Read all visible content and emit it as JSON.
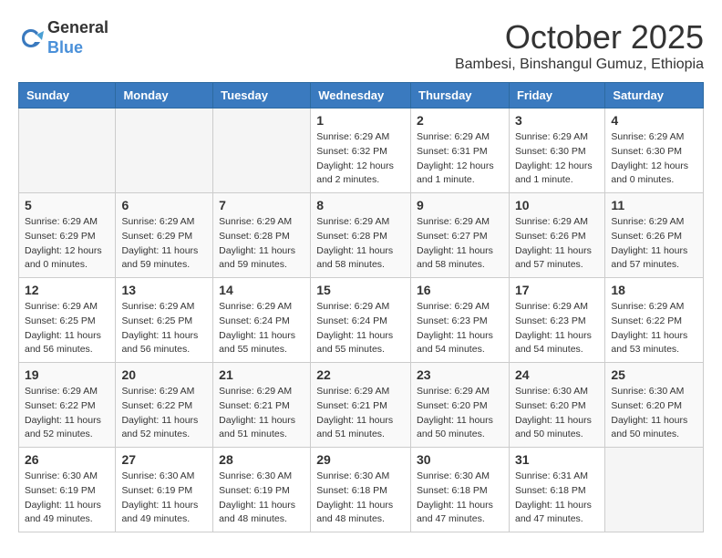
{
  "header": {
    "logo": {
      "line1": "General",
      "line2": "Blue"
    },
    "title": "October 2025",
    "subtitle": "Bambesi, Binshangul Gumuz, Ethiopia"
  },
  "calendar": {
    "days_of_week": [
      "Sunday",
      "Monday",
      "Tuesday",
      "Wednesday",
      "Thursday",
      "Friday",
      "Saturday"
    ],
    "weeks": [
      [
        {
          "day": "",
          "info": ""
        },
        {
          "day": "",
          "info": ""
        },
        {
          "day": "",
          "info": ""
        },
        {
          "day": "1",
          "info": "Sunrise: 6:29 AM\nSunset: 6:32 PM\nDaylight: 12 hours\nand 2 minutes."
        },
        {
          "day": "2",
          "info": "Sunrise: 6:29 AM\nSunset: 6:31 PM\nDaylight: 12 hours\nand 1 minute."
        },
        {
          "day": "3",
          "info": "Sunrise: 6:29 AM\nSunset: 6:30 PM\nDaylight: 12 hours\nand 1 minute."
        },
        {
          "day": "4",
          "info": "Sunrise: 6:29 AM\nSunset: 6:30 PM\nDaylight: 12 hours\nand 0 minutes."
        }
      ],
      [
        {
          "day": "5",
          "info": "Sunrise: 6:29 AM\nSunset: 6:29 PM\nDaylight: 12 hours\nand 0 minutes."
        },
        {
          "day": "6",
          "info": "Sunrise: 6:29 AM\nSunset: 6:29 PM\nDaylight: 11 hours\nand 59 minutes."
        },
        {
          "day": "7",
          "info": "Sunrise: 6:29 AM\nSunset: 6:28 PM\nDaylight: 11 hours\nand 59 minutes."
        },
        {
          "day": "8",
          "info": "Sunrise: 6:29 AM\nSunset: 6:28 PM\nDaylight: 11 hours\nand 58 minutes."
        },
        {
          "day": "9",
          "info": "Sunrise: 6:29 AM\nSunset: 6:27 PM\nDaylight: 11 hours\nand 58 minutes."
        },
        {
          "day": "10",
          "info": "Sunrise: 6:29 AM\nSunset: 6:26 PM\nDaylight: 11 hours\nand 57 minutes."
        },
        {
          "day": "11",
          "info": "Sunrise: 6:29 AM\nSunset: 6:26 PM\nDaylight: 11 hours\nand 57 minutes."
        }
      ],
      [
        {
          "day": "12",
          "info": "Sunrise: 6:29 AM\nSunset: 6:25 PM\nDaylight: 11 hours\nand 56 minutes."
        },
        {
          "day": "13",
          "info": "Sunrise: 6:29 AM\nSunset: 6:25 PM\nDaylight: 11 hours\nand 56 minutes."
        },
        {
          "day": "14",
          "info": "Sunrise: 6:29 AM\nSunset: 6:24 PM\nDaylight: 11 hours\nand 55 minutes."
        },
        {
          "day": "15",
          "info": "Sunrise: 6:29 AM\nSunset: 6:24 PM\nDaylight: 11 hours\nand 55 minutes."
        },
        {
          "day": "16",
          "info": "Sunrise: 6:29 AM\nSunset: 6:23 PM\nDaylight: 11 hours\nand 54 minutes."
        },
        {
          "day": "17",
          "info": "Sunrise: 6:29 AM\nSunset: 6:23 PM\nDaylight: 11 hours\nand 54 minutes."
        },
        {
          "day": "18",
          "info": "Sunrise: 6:29 AM\nSunset: 6:22 PM\nDaylight: 11 hours\nand 53 minutes."
        }
      ],
      [
        {
          "day": "19",
          "info": "Sunrise: 6:29 AM\nSunset: 6:22 PM\nDaylight: 11 hours\nand 52 minutes."
        },
        {
          "day": "20",
          "info": "Sunrise: 6:29 AM\nSunset: 6:22 PM\nDaylight: 11 hours\nand 52 minutes."
        },
        {
          "day": "21",
          "info": "Sunrise: 6:29 AM\nSunset: 6:21 PM\nDaylight: 11 hours\nand 51 minutes."
        },
        {
          "day": "22",
          "info": "Sunrise: 6:29 AM\nSunset: 6:21 PM\nDaylight: 11 hours\nand 51 minutes."
        },
        {
          "day": "23",
          "info": "Sunrise: 6:29 AM\nSunset: 6:20 PM\nDaylight: 11 hours\nand 50 minutes."
        },
        {
          "day": "24",
          "info": "Sunrise: 6:30 AM\nSunset: 6:20 PM\nDaylight: 11 hours\nand 50 minutes."
        },
        {
          "day": "25",
          "info": "Sunrise: 6:30 AM\nSunset: 6:20 PM\nDaylight: 11 hours\nand 50 minutes."
        }
      ],
      [
        {
          "day": "26",
          "info": "Sunrise: 6:30 AM\nSunset: 6:19 PM\nDaylight: 11 hours\nand 49 minutes."
        },
        {
          "day": "27",
          "info": "Sunrise: 6:30 AM\nSunset: 6:19 PM\nDaylight: 11 hours\nand 49 minutes."
        },
        {
          "day": "28",
          "info": "Sunrise: 6:30 AM\nSunset: 6:19 PM\nDaylight: 11 hours\nand 48 minutes."
        },
        {
          "day": "29",
          "info": "Sunrise: 6:30 AM\nSunset: 6:18 PM\nDaylight: 11 hours\nand 48 minutes."
        },
        {
          "day": "30",
          "info": "Sunrise: 6:30 AM\nSunset: 6:18 PM\nDaylight: 11 hours\nand 47 minutes."
        },
        {
          "day": "31",
          "info": "Sunrise: 6:31 AM\nSunset: 6:18 PM\nDaylight: 11 hours\nand 47 minutes."
        },
        {
          "day": "",
          "info": ""
        }
      ]
    ]
  }
}
